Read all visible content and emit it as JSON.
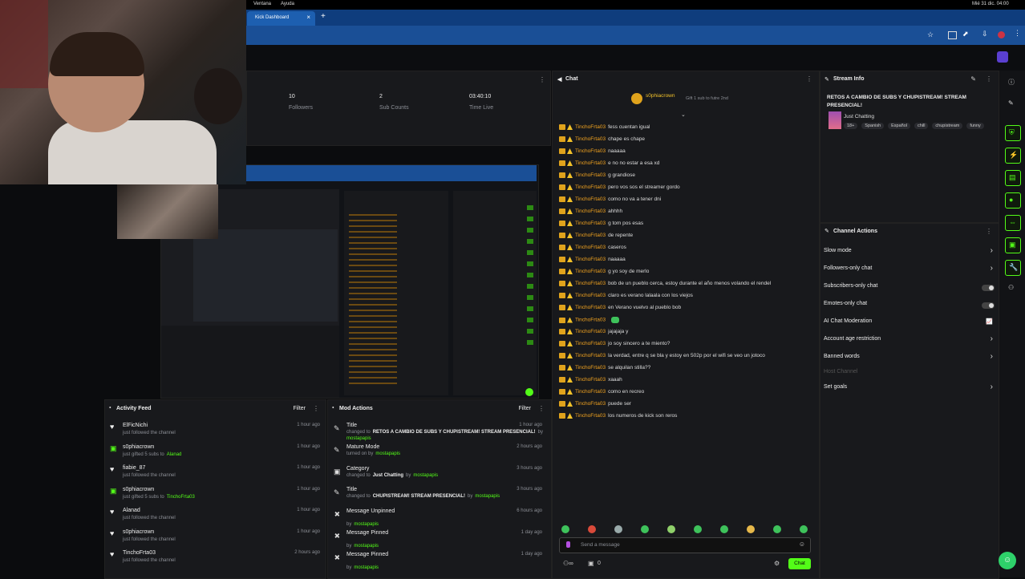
{
  "menubar": {
    "items": [
      "Ventana",
      "Ayuda"
    ],
    "clock": "Mié 31 dic. 04:00"
  },
  "browser": {
    "tab_title": "Kick Dashboard"
  },
  "stats": [
    {
      "value": "10",
      "label": "Followers"
    },
    {
      "value": "2",
      "label": "Sub Counts"
    },
    {
      "value": "03:40:10",
      "label": "Time Live"
    }
  ],
  "chat": {
    "title": "Chat",
    "pinned_user": "s0phiacrown",
    "pinned_text": "Gift 1 sub to futre 2nd",
    "messages": [
      {
        "user": "TinchoFrta03",
        "text": "fess cuentan igual"
      },
      {
        "user": "TinchoFrta03",
        "text": "chape es chape"
      },
      {
        "user": "TinchoFrta03",
        "text": "naaaaa"
      },
      {
        "user": "TinchoFrta03",
        "text": "e no no estar a esa xd"
      },
      {
        "user": "TinchoFrta03",
        "text": "g grandiose"
      },
      {
        "user": "TinchoFrta03",
        "text": "pero vos sos el streamer gordo"
      },
      {
        "user": "TinchoFrta03",
        "text": "como no va a tener dni"
      },
      {
        "user": "TinchoFrta03",
        "text": "ahhhh"
      },
      {
        "user": "TinchoFrta03",
        "text": "g tom pos esas"
      },
      {
        "user": "TinchoFrta03",
        "text": "de repente"
      },
      {
        "user": "TinchoFrta03",
        "text": "caseros"
      },
      {
        "user": "TinchoFrta03",
        "text": "naaaaa"
      },
      {
        "user": "TinchoFrta03",
        "text": "g yo soy de merlo"
      },
      {
        "user": "TinchoFrta03",
        "text": "bob de un pueblo cerca, estoy durante el año menos volando el rendel"
      },
      {
        "user": "TinchoFrta03",
        "text": "claro es verano lalaala con los viejos"
      },
      {
        "user": "TinchoFrta03",
        "text": "en Verano vuelvo al pueblo bob"
      },
      {
        "user": "TinchoFrta03",
        "text": ""
      },
      {
        "user": "TinchoFrta03",
        "text": "jajajaja y"
      },
      {
        "user": "TinchoFrta03",
        "text": "jo soy sincero a te miento?"
      },
      {
        "user": "TinchoFrta03",
        "text": "la verdad, entre q se bla y estoy en 502p por el wifi se veo un jotoco"
      },
      {
        "user": "TinchoFrta03",
        "text": "se alquilan stilla??"
      },
      {
        "user": "TinchoFrta03",
        "text": "xaaah"
      },
      {
        "user": "TinchoFrta03",
        "text": "como en recreo"
      },
      {
        "user": "TinchoFrta03",
        "text": "puede ser"
      },
      {
        "user": "TinchoFrta03",
        "text": "los numeros de kick son reros"
      }
    ],
    "input_placeholder": "Send a message",
    "viewer_count": "0",
    "send_label": "Chat"
  },
  "stream_info": {
    "title": "Stream Info",
    "stream_title": "RETOS A CAMBIO DE SUBS Y CHUPISTREAM! STREAM PRESENCIAL!",
    "category": "Just Chatting",
    "tags": [
      "18+",
      "Spanish",
      "Español",
      "chill",
      "chupistream",
      "funny"
    ]
  },
  "channel_actions": {
    "title": "Channel Actions",
    "items": [
      {
        "label": "Slow mode",
        "control": "chevron"
      },
      {
        "label": "Followers-only chat",
        "control": "chevron"
      },
      {
        "label": "Subscribers-only chat",
        "control": "toggle"
      },
      {
        "label": "Emotes-only chat",
        "control": "toggle"
      },
      {
        "label": "AI Chat Moderation",
        "control": "chart"
      },
      {
        "label": "Account age restriction",
        "control": "chevron"
      },
      {
        "label": "Banned words",
        "control": "chevron"
      },
      {
        "label": "Host Channel",
        "control": "none"
      },
      {
        "label": "Set goals",
        "control": "chevron"
      }
    ]
  },
  "activity_feed": {
    "title": "Activity Feed",
    "filter_label": "Filter",
    "items": [
      {
        "name": "ElFicNichi",
        "sub": "just followed the channel",
        "time": "1 hour ago",
        "kind": "follow"
      },
      {
        "name": "s0phiacrown",
        "sub_prefix": "just gifted 5 subs to",
        "sub_target": "Alanad",
        "time": "1 hour ago",
        "kind": "gift"
      },
      {
        "name": "fiabie_87",
        "sub": "just followed the channel",
        "time": "1 hour ago",
        "kind": "follow"
      },
      {
        "name": "s0phiacrown",
        "sub_prefix": "just gifted 5 subs to",
        "sub_target": "TinchoFrta03",
        "time": "1 hour ago",
        "kind": "gift"
      },
      {
        "name": "Alanad",
        "sub": "just followed the channel",
        "time": "1 hour ago",
        "kind": "follow"
      },
      {
        "name": "s0phiacrown",
        "sub": "just followed the channel",
        "time": "1 hour ago",
        "kind": "follow"
      },
      {
        "name": "TinchoFrta03",
        "sub": "just followed the channel",
        "time": "2 hours ago",
        "kind": "follow"
      }
    ]
  },
  "mod_actions": {
    "title": "Mod Actions",
    "filter_label": "Filter",
    "items": [
      {
        "title": "Title",
        "sub_prefix": "changed to",
        "sub_bold": "RETOS A CAMBIO DE SUBS Y CHUPISTREAM! STREAM PRESENCIAL!",
        "sub_mid": "by",
        "by": "mostapapis",
        "time": "1 hour ago",
        "icon": "pen-icon",
        "glyph": "✎"
      },
      {
        "title": "Mature Mode",
        "sub_prefix": "turned on by",
        "sub_bold": "",
        "sub_mid": "",
        "by": "mostapapis",
        "time": "2 hours ago",
        "icon": "pen-icon",
        "glyph": "✎"
      },
      {
        "title": "Category",
        "sub_prefix": "changed to",
        "sub_bold": "Just Chatting",
        "sub_mid": "by",
        "by": "mostapapis",
        "time": "3 hours ago",
        "icon": "category-icon",
        "glyph": "▣"
      },
      {
        "title": "Title",
        "sub_prefix": "changed to",
        "sub_bold": "CHUPISTREAM! STREAM PRESENCIAL!",
        "sub_mid": "by",
        "by": "mostapapis",
        "time": "3 hours ago",
        "icon": "pen-icon",
        "glyph": "✎"
      },
      {
        "title": "Message Unpinned",
        "sub_prefix": "by",
        "sub_bold": "",
        "sub_mid": "",
        "by": "mostapapis",
        "time": "6 hours ago",
        "icon": "pin-icon",
        "glyph": "📌"
      },
      {
        "title": "Message Pinned",
        "sub_prefix": "by",
        "sub_bold": "",
        "sub_mid": "",
        "by": "mostapapis",
        "time": "1 day ago",
        "icon": "pin-icon",
        "glyph": "📌"
      },
      {
        "title": "Message Pinned",
        "sub_prefix": "by",
        "sub_bold": "",
        "sub_mid": "",
        "by": "mostapapis",
        "time": "1 day ago",
        "icon": "pin-icon",
        "glyph": "📌"
      }
    ]
  },
  "colors": {
    "accent": "#53fc18",
    "username": "#f2a31f",
    "browser_bar": "#1a4f96"
  }
}
